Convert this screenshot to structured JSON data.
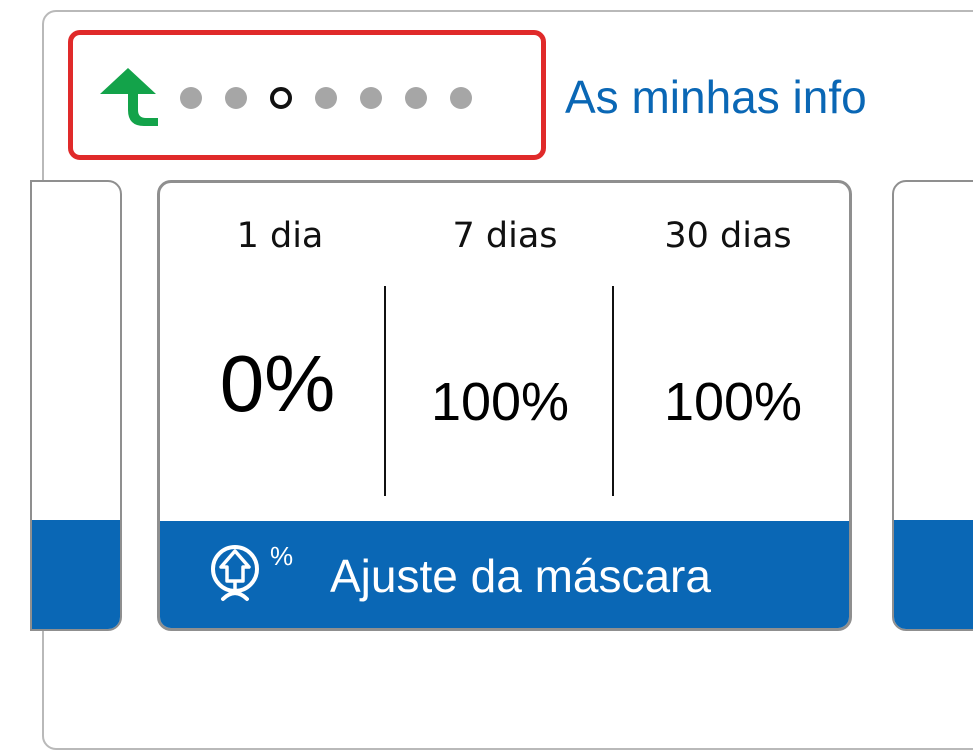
{
  "header": {
    "title": "As minhas info",
    "back_icon": "back-arrow-icon",
    "pager": {
      "total": 7,
      "active_index": 2
    }
  },
  "card": {
    "periods": [
      {
        "label": "1 dia",
        "value": "0%"
      },
      {
        "label": "7 dias",
        "value": "100%"
      },
      {
        "label": "30 dias",
        "value": "100%"
      }
    ],
    "footer": {
      "icon": "mask-fit-icon",
      "icon_superscript": "%",
      "label": "Ajuste da máscara"
    }
  },
  "colors": {
    "accent_blue": "#0a67b5",
    "highlight_red": "#e02a2a",
    "back_green": "#13a34a",
    "dot_gray": "#a6a6a6"
  }
}
